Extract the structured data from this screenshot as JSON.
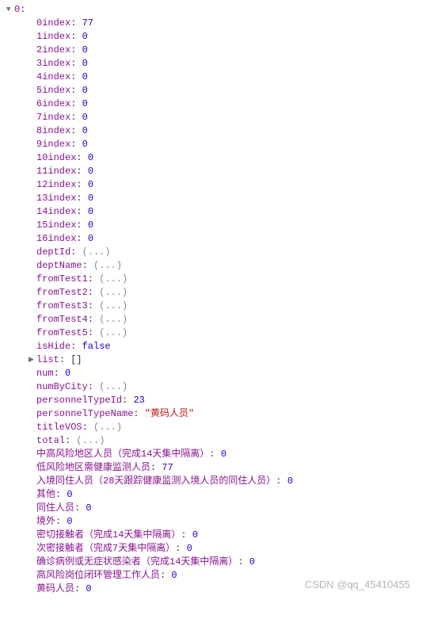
{
  "root": {
    "key": "0",
    "expanded": true
  },
  "fields": [
    {
      "key": "0index",
      "type": "num",
      "value": 77
    },
    {
      "key": "1index",
      "type": "num",
      "value": 0
    },
    {
      "key": "2index",
      "type": "num",
      "value": 0
    },
    {
      "key": "3index",
      "type": "num",
      "value": 0
    },
    {
      "key": "4index",
      "type": "num",
      "value": 0
    },
    {
      "key": "5index",
      "type": "num",
      "value": 0
    },
    {
      "key": "6index",
      "type": "num",
      "value": 0
    },
    {
      "key": "7index",
      "type": "num",
      "value": 0
    },
    {
      "key": "8index",
      "type": "num",
      "value": 0
    },
    {
      "key": "9index",
      "type": "num",
      "value": 0
    },
    {
      "key": "10index",
      "type": "num",
      "value": 0
    },
    {
      "key": "11index",
      "type": "num",
      "value": 0
    },
    {
      "key": "12index",
      "type": "num",
      "value": 0
    },
    {
      "key": "13index",
      "type": "num",
      "value": 0
    },
    {
      "key": "14index",
      "type": "num",
      "value": 0
    },
    {
      "key": "15index",
      "type": "num",
      "value": 0
    },
    {
      "key": "16index",
      "type": "num",
      "value": 0
    },
    {
      "key": "deptId",
      "type": "ellipsis"
    },
    {
      "key": "deptName",
      "type": "ellipsis"
    },
    {
      "key": "fromTest1",
      "type": "ellipsis"
    },
    {
      "key": "fromTest2",
      "type": "ellipsis"
    },
    {
      "key": "fromTest3",
      "type": "ellipsis"
    },
    {
      "key": "fromTest4",
      "type": "ellipsis"
    },
    {
      "key": "fromTest5",
      "type": "ellipsis"
    },
    {
      "key": "isHide",
      "type": "bool",
      "value": "false"
    },
    {
      "key": "list",
      "type": "array"
    },
    {
      "key": "num",
      "type": "num",
      "value": 0
    },
    {
      "key": "numByCity",
      "type": "ellipsis"
    },
    {
      "key": "personnelTypeId",
      "type": "num",
      "value": 23
    },
    {
      "key": "personnelTypeName",
      "type": "str",
      "value": "\"黄码人员\""
    },
    {
      "key": "titleVOS",
      "type": "ellipsis"
    },
    {
      "key": "total",
      "type": "ellipsis"
    },
    {
      "key": "中高风险地区人员（完成14天集中隔离）",
      "type": "num",
      "value": 0
    },
    {
      "key": "低风险地区需健康监测人员",
      "type": "num",
      "value": 77
    },
    {
      "key": "入境同住人员（28天跟踪健康监测入境人员的同住人员）",
      "type": "num",
      "value": 0
    },
    {
      "key": "其他",
      "type": "num",
      "value": 0
    },
    {
      "key": "同住人员",
      "type": "num",
      "value": 0
    },
    {
      "key": "境外",
      "type": "num",
      "value": 0
    },
    {
      "key": "密切接触者（完成14天集中隔离）",
      "type": "num",
      "value": 0
    },
    {
      "key": "次密接触者（完成7天集中隔离）",
      "type": "num",
      "value": 0
    },
    {
      "key": "确诊病例或无症状感染者（完成14天集中隔离）",
      "type": "num",
      "value": 0
    },
    {
      "key": "高风险岗位闭环管理工作人员",
      "type": "num",
      "value": 0
    },
    {
      "key": "黄码人员",
      "type": "num",
      "value": 0
    }
  ],
  "arrayEmpty": "[]",
  "ellipsisText": "(...)",
  "watermark": "CSDN @qq_45410455"
}
